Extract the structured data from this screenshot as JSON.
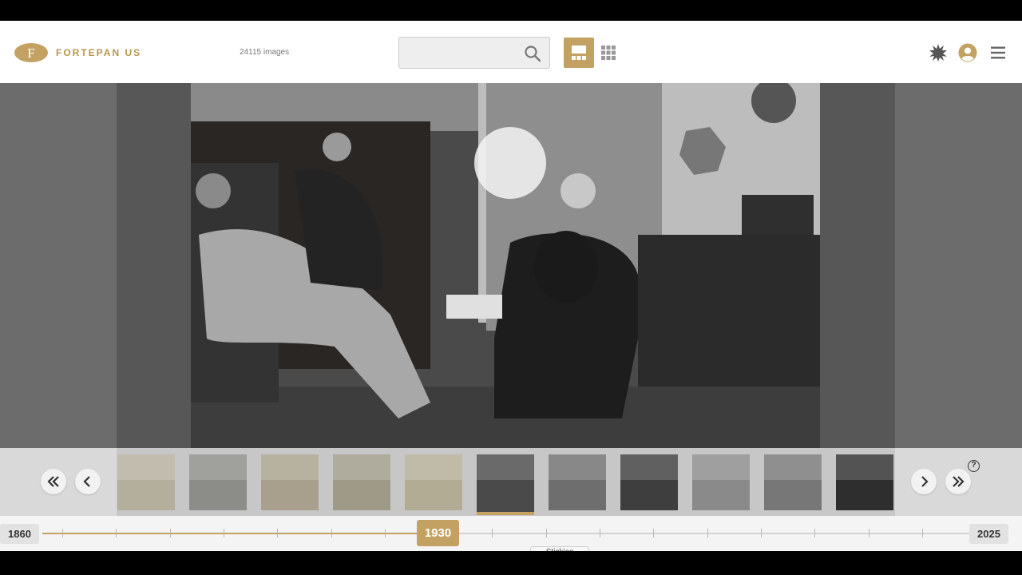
{
  "header": {
    "logo_text": "FORTEPAN US",
    "image_count": "24115 images",
    "search": {
      "value": "",
      "placeholder": ""
    },
    "icons": [
      "search-icon",
      "single-view-icon",
      "grid-view-icon",
      "theme-toggle-icon",
      "account-icon",
      "menu-icon"
    ]
  },
  "viewer": {
    "photo_alt": "Black and white photograph of a living room with people seated"
  },
  "filmstrip": {
    "thumbnails": [
      {
        "tone": "#b4ae9d"
      },
      {
        "tone": "#8c8c88"
      },
      {
        "tone": "#a8a08c"
      },
      {
        "tone": "#9f9a88"
      },
      {
        "tone": "#b3ac95"
      },
      {
        "tone": "#4a4a4a",
        "active": true
      },
      {
        "tone": "#6e6e6e"
      },
      {
        "tone": "#3e3e3e"
      },
      {
        "tone": "#8a8a8a"
      },
      {
        "tone": "#777"
      },
      {
        "tone": "#2e2e2e"
      }
    ],
    "help_label": "?"
  },
  "timeline": {
    "start_year": "1860",
    "end_year": "2025",
    "current_year": "1930",
    "caption": "Stickies"
  },
  "colors": {
    "accent": "#c2a162",
    "header_bg": "#ffffff",
    "timeline_bg": "#f4f4f4"
  }
}
